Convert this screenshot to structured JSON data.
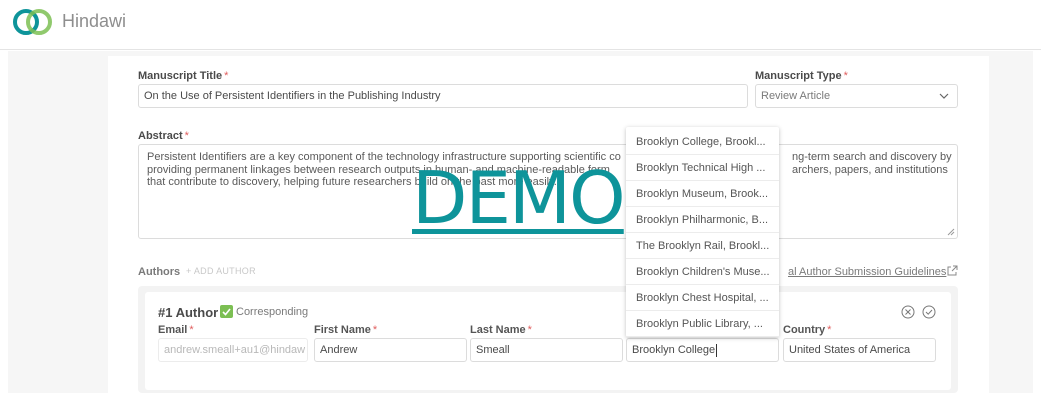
{
  "header": {
    "brand": "Hindawi",
    "logo_colors": [
      "#0e949a",
      "#7cbf53"
    ]
  },
  "form": {
    "manuscript_title": {
      "label": "Manuscript Title",
      "required_mark": "*",
      "value": "On the Use of Persistent Identifiers in the Publishing Industry"
    },
    "manuscript_type": {
      "label": "Manuscript Type",
      "required_mark": "*",
      "value": "Review Article"
    },
    "abstract": {
      "label": "Abstract",
      "required_mark": "*",
      "line1": "Persistent Identifiers are a key component of the technology infrastructure supporting scientific co",
      "line1_right": "ng-term search and discovery by",
      "line2": "providing permanent linkages between research outputs in human- and machine-readable form",
      "line2_right": "archers, papers, and institutions",
      "line3": "that contribute to discovery, helping future researchers build on the past more easily."
    },
    "authors": {
      "label": "Authors",
      "add_label": "+ ADD AUTHOR",
      "guidelines_link": "al Author Submission Guidelines"
    },
    "author_card": {
      "number": "#1 Author",
      "corresponding": "Corresponding",
      "email_label": "Email",
      "email_value": "andrew.smeall+au1@hindaw",
      "first_name_label": "First Name",
      "first_name_value": "Andrew",
      "last_name_label": "Last Name",
      "last_name_value": "Smeall",
      "affiliation_value": "Brooklyn College",
      "country_label": "Country",
      "country_value": "United States of America",
      "required_mark": "*"
    }
  },
  "affiliation_suggestions": [
    "Brooklyn College, Brookl...",
    "Brooklyn Technical High ...",
    "Brooklyn Museum, Brook...",
    "Brooklyn Philharmonic, B...",
    "The Brooklyn Rail, Brookl...",
    "Brooklyn Children's Muse...",
    "Brooklyn Chest Hospital, ...",
    "Brooklyn Public Library, ..."
  ],
  "watermark": "DEMO"
}
